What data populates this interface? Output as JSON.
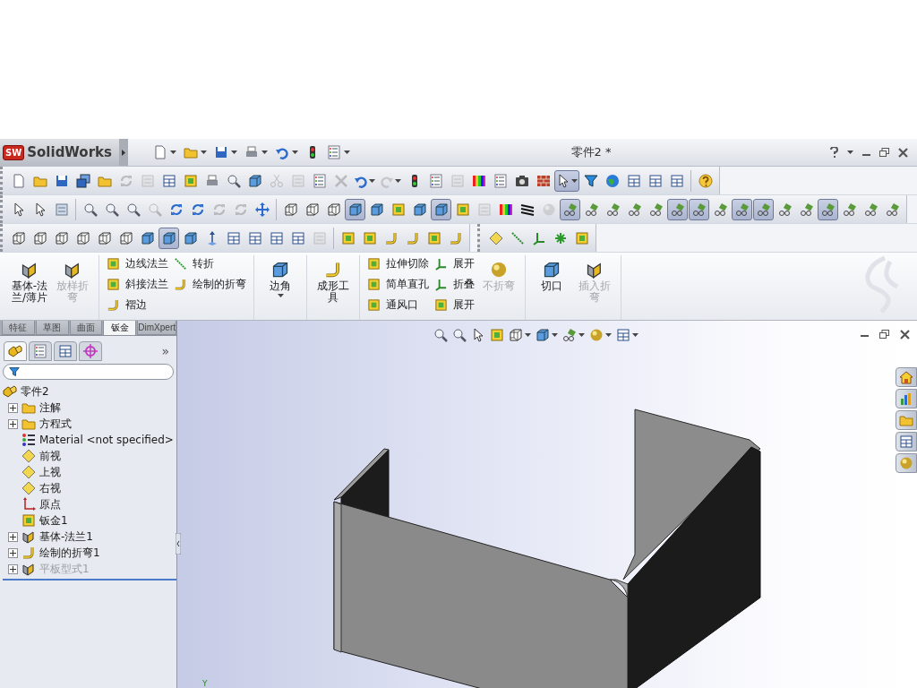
{
  "app": {
    "logo_badge": "SW",
    "logo": "SolidWorks",
    "title": "零件2 *"
  },
  "quick_access": [
    {
      "kind": "page",
      "menu": true
    },
    {
      "kind": "folder",
      "menu": true
    },
    {
      "kind": "save",
      "menu": true
    },
    {
      "kind": "print",
      "menu": true
    },
    {
      "kind": "undo",
      "menu": true
    },
    {
      "kind": "traffic",
      "menu": false
    },
    {
      "kind": "list",
      "menu": true
    }
  ],
  "toolbar_rows": [
    {
      "toolbars": [
        {
          "groups": [
            {
              "buttons": [
                {
                  "kind": "page",
                  "selected": false,
                  "disabled": false
                },
                {
                  "kind": "folder",
                  "selected": false,
                  "disabled": false
                },
                {
                  "kind": "save",
                  "selected": false,
                  "disabled": false
                },
                {
                  "kind": "windows",
                  "selected": false,
                  "disabled": false
                },
                {
                  "kind": "folder",
                  "selected": false,
                  "disabled": false
                },
                {
                  "kind": "rotate",
                  "selected": false,
                  "disabled": true
                },
                {
                  "kind": "tile",
                  "selected": false,
                  "disabled": true
                },
                {
                  "kind": "layout",
                  "selected": false,
                  "disabled": false
                },
                {
                  "kind": "sheet",
                  "selected": false,
                  "disabled": false
                },
                {
                  "kind": "print",
                  "selected": false,
                  "disabled": false
                },
                {
                  "kind": "zoom",
                  "selected": false,
                  "disabled": false
                },
                {
                  "kind": "cube",
                  "selected": false,
                  "disabled": false
                },
                {
                  "kind": "scissors",
                  "selected": false,
                  "disabled": true
                },
                {
                  "kind": "tile",
                  "selected": false,
                  "disabled": true
                },
                {
                  "kind": "list",
                  "selected": false,
                  "disabled": false
                },
                {
                  "kind": "delete",
                  "selected": false,
                  "disabled": true
                },
                {
                  "kind": "undo",
                  "selected": false,
                  "disabled": false,
                  "menu": true
                },
                {
                  "kind": "redo",
                  "selected": false,
                  "disabled": true,
                  "menu": true
                },
                {
                  "kind": "traffic",
                  "selected": false,
                  "disabled": false
                },
                {
                  "kind": "list",
                  "selected": false,
                  "disabled": false
                },
                {
                  "kind": "tile",
                  "selected": false,
                  "disabled": true
                },
                {
                  "kind": "rainbow",
                  "selected": false,
                  "disabled": false
                },
                {
                  "kind": "list",
                  "selected": false,
                  "disabled": false
                },
                {
                  "kind": "camera",
                  "selected": false,
                  "disabled": false
                },
                {
                  "kind": "brick",
                  "selected": false,
                  "disabled": false
                },
                {
                  "kind": "pointer",
                  "selected": true,
                  "disabled": false,
                  "menu": true
                },
                {
                  "kind": "filter",
                  "selected": false,
                  "disabled": false
                },
                {
                  "kind": "globe",
                  "selected": false,
                  "disabled": false
                },
                {
                  "kind": "layout",
                  "selected": false,
                  "disabled": false
                },
                {
                  "kind": "layout",
                  "selected": false,
                  "disabled": false
                },
                {
                  "kind": "layout",
                  "selected": false,
                  "disabled": false
                }
              ]
            },
            {
              "buttons": [
                {
                  "kind": "help",
                  "selected": false,
                  "disabled": false
                }
              ]
            }
          ]
        }
      ]
    },
    {
      "toolbars": [
        {
          "groups": [
            {
              "buttons": [
                {
                  "kind": "pointer",
                  "selected": false,
                  "disabled": false
                },
                {
                  "kind": "pointer",
                  "selected": false,
                  "disabled": false
                },
                {
                  "kind": "tile",
                  "selected": false,
                  "disabled": false
                }
              ]
            },
            {
              "buttons": [
                {
                  "kind": "zoom",
                  "selected": false,
                  "disabled": false
                },
                {
                  "kind": "zoom",
                  "selected": false,
                  "disabled": false
                },
                {
                  "kind": "zoom",
                  "selected": false,
                  "disabled": false
                },
                {
                  "kind": "zoom",
                  "selected": false,
                  "disabled": true
                },
                {
                  "kind": "rotate",
                  "selected": false,
                  "disabled": false
                },
                {
                  "kind": "rotate",
                  "selected": false,
                  "disabled": false
                },
                {
                  "kind": "rotate",
                  "selected": false,
                  "disabled": true
                },
                {
                  "kind": "rotate",
                  "selected": false,
                  "disabled": true
                },
                {
                  "kind": "pan",
                  "selected": false,
                  "disabled": false
                }
              ]
            },
            {
              "buttons": [
                {
                  "kind": "wirecube",
                  "selected": false,
                  "disabled": false
                },
                {
                  "kind": "wirecube",
                  "selected": false,
                  "disabled": false
                },
                {
                  "kind": "wirecube",
                  "selected": false,
                  "disabled": false
                },
                {
                  "kind": "cube",
                  "selected": true,
                  "disabled": false
                },
                {
                  "kind": "cube",
                  "selected": false,
                  "disabled": false
                },
                {
                  "kind": "sheet",
                  "selected": false,
                  "disabled": false
                },
                {
                  "kind": "cube",
                  "selected": false,
                  "disabled": false
                },
                {
                  "kind": "cube",
                  "selected": true,
                  "disabled": false
                },
                {
                  "kind": "sheet",
                  "selected": false,
                  "disabled": false
                },
                {
                  "kind": "tile",
                  "selected": false,
                  "disabled": true
                },
                {
                  "kind": "rainbow",
                  "selected": false,
                  "disabled": false
                },
                {
                  "kind": "zebra",
                  "selected": false,
                  "disabled": false
                },
                {
                  "kind": "sphere",
                  "selected": false,
                  "disabled": true
                },
                {
                  "kind": "glasses",
                  "selected": true,
                  "disabled": false
                },
                {
                  "kind": "glasses",
                  "selected": false,
                  "disabled": false
                },
                {
                  "kind": "glasses",
                  "selected": false,
                  "disabled": false
                },
                {
                  "kind": "glasses",
                  "selected": false,
                  "disabled": false
                },
                {
                  "kind": "glasses",
                  "selected": false,
                  "disabled": false
                },
                {
                  "kind": "glasses",
                  "selected": true,
                  "disabled": false
                },
                {
                  "kind": "glasses",
                  "selected": true,
                  "disabled": false
                },
                {
                  "kind": "glasses",
                  "selected": false,
                  "disabled": false
                },
                {
                  "kind": "glasses",
                  "selected": true,
                  "disabled": false
                },
                {
                  "kind": "glasses",
                  "selected": true,
                  "disabled": false
                },
                {
                  "kind": "glasses",
                  "selected": false,
                  "disabled": false
                },
                {
                  "kind": "glasses",
                  "selected": false,
                  "disabled": false
                },
                {
                  "kind": "glasses",
                  "selected": true,
                  "disabled": false
                },
                {
                  "kind": "glasses",
                  "selected": false,
                  "disabled": false
                },
                {
                  "kind": "glasses",
                  "selected": false,
                  "disabled": false
                },
                {
                  "kind": "glasses",
                  "selected": false,
                  "disabled": false
                }
              ]
            }
          ]
        }
      ]
    },
    {
      "toolbars": [
        {
          "groups": [
            {
              "buttons": [
                {
                  "kind": "wirecube",
                  "selected": false,
                  "disabled": false
                },
                {
                  "kind": "wirecube",
                  "selected": false,
                  "disabled": false
                },
                {
                  "kind": "wirecube",
                  "selected": false,
                  "disabled": false
                },
                {
                  "kind": "wirecube",
                  "selected": false,
                  "disabled": false
                },
                {
                  "kind": "wirecube",
                  "selected": false,
                  "disabled": false
                },
                {
                  "kind": "wirecube",
                  "selected": false,
                  "disabled": false
                },
                {
                  "kind": "cube",
                  "selected": false,
                  "disabled": false
                },
                {
                  "kind": "cube",
                  "selected": true,
                  "disabled": false
                },
                {
                  "kind": "cube",
                  "selected": false,
                  "disabled": false
                },
                {
                  "kind": "arrow",
                  "selected": false,
                  "disabled": false
                },
                {
                  "kind": "layout",
                  "selected": false,
                  "disabled": false
                },
                {
                  "kind": "layout",
                  "selected": false,
                  "disabled": false
                },
                {
                  "kind": "layout",
                  "selected": false,
                  "disabled": false
                },
                {
                  "kind": "layout",
                  "selected": false,
                  "disabled": false
                },
                {
                  "kind": "tile",
                  "selected": false,
                  "disabled": true
                }
              ]
            },
            {
              "buttons": [
                {
                  "kind": "sheet",
                  "selected": false,
                  "disabled": false
                },
                {
                  "kind": "sheet",
                  "selected": false,
                  "disabled": false
                },
                {
                  "kind": "bend",
                  "selected": false,
                  "disabled": false
                },
                {
                  "kind": "bend",
                  "selected": false,
                  "disabled": false
                },
                {
                  "kind": "sheet",
                  "selected": false,
                  "disabled": false
                },
                {
                  "kind": "bend",
                  "selected": false,
                  "disabled": false
                }
              ]
            }
          ]
        },
        {
          "groups": [
            {
              "buttons": [
                {
                  "kind": "plane",
                  "selected": false,
                  "disabled": false
                },
                {
                  "kind": "line",
                  "selected": false,
                  "disabled": false
                },
                {
                  "kind": "axes",
                  "selected": false,
                  "disabled": false
                },
                {
                  "kind": "point",
                  "selected": false,
                  "disabled": false
                },
                {
                  "kind": "sheet",
                  "selected": false,
                  "disabled": false
                }
              ]
            }
          ]
        }
      ]
    }
  ],
  "ribbon": [
    {
      "items": [
        {
          "kind": "large",
          "label": "基体-法兰/薄片",
          "disabled": false,
          "menu": false
        },
        {
          "kind": "large",
          "label": "放样折弯",
          "disabled": true,
          "menu": false
        }
      ]
    },
    {
      "items": [
        {
          "kind": "small",
          "label": "边线法兰",
          "disabled": false
        },
        {
          "kind": "small",
          "label": "斜接法兰",
          "disabled": false
        },
        {
          "kind": "small",
          "label": "褶边",
          "disabled": false
        },
        {
          "kind": "small",
          "label": "转折",
          "disabled": false
        },
        {
          "kind": "small",
          "label": "绘制的折弯",
          "disabled": false
        }
      ]
    },
    {
      "items": [
        {
          "kind": "large",
          "label": "边角",
          "disabled": false,
          "menu": true
        }
      ]
    },
    {
      "items": [
        {
          "kind": "large",
          "label": "成形工具",
          "disabled": false,
          "menu": false
        }
      ]
    },
    {
      "items": [
        {
          "kind": "small",
          "label": "拉伸切除",
          "disabled": false
        },
        {
          "kind": "small",
          "label": "简单直孔",
          "disabled": false
        },
        {
          "kind": "small",
          "label": "通风口",
          "disabled": false
        },
        {
          "kind": "small",
          "label": "展开",
          "disabled": false
        },
        {
          "kind": "small",
          "label": "折叠",
          "disabled": false
        },
        {
          "kind": "small",
          "label": "展开",
          "disabled": false
        },
        {
          "kind": "large",
          "label": "不折弯",
          "disabled": true,
          "menu": false
        }
      ]
    },
    {
      "items": [
        {
          "kind": "large",
          "label": "切口",
          "disabled": false,
          "menu": false
        },
        {
          "kind": "large",
          "label": "插入折弯",
          "disabled": true,
          "menu": false
        }
      ]
    }
  ],
  "tabs": [
    {
      "label": "特征",
      "selected": false
    },
    {
      "label": "草图",
      "selected": false
    },
    {
      "label": "曲面",
      "selected": false
    },
    {
      "label": "钣金",
      "selected": true
    },
    {
      "label": "DimXpert",
      "selected": false
    }
  ],
  "panel_tabs": [
    {
      "kind": "part",
      "selected": true
    },
    {
      "kind": "list",
      "selected": false
    },
    {
      "kind": "layout",
      "selected": false
    },
    {
      "kind": "target",
      "selected": false
    }
  ],
  "panel_more": "»",
  "feature_tree": {
    "label": "零件2",
    "children": [
      {
        "label": "注解",
        "has_children": true,
        "disabled": false
      },
      {
        "label": "方程式",
        "has_children": true,
        "disabled": false
      },
      {
        "label": "Material <not specified>",
        "has_children": false,
        "disabled": false
      },
      {
        "label": "前视",
        "has_children": false,
        "disabled": false
      },
      {
        "label": "上视",
        "has_children": false,
        "disabled": false
      },
      {
        "label": "右视",
        "has_children": false,
        "disabled": false
      },
      {
        "label": "原点",
        "has_children": false,
        "disabled": false
      },
      {
        "label": "钣金1",
        "has_children": false,
        "disabled": false
      },
      {
        "label": "基体-法兰1",
        "has_children": true,
        "disabled": false
      },
      {
        "label": "绘制的折弯1",
        "has_children": true,
        "disabled": false
      },
      {
        "label": "平板型式1",
        "has_children": true,
        "disabled": true
      }
    ]
  },
  "viewport": {
    "hud": [
      {
        "kind": "zoom",
        "menu": false
      },
      {
        "kind": "zoom",
        "menu": false
      },
      {
        "kind": "pointer",
        "menu": false
      },
      {
        "kind": "sheet",
        "menu": false
      },
      {
        "kind": "wirecube",
        "menu": true
      },
      {
        "kind": "cube",
        "menu": true
      },
      {
        "kind": "glasses",
        "menu": true
      },
      {
        "kind": "sphere",
        "menu": true
      },
      {
        "kind": "layout",
        "menu": true
      }
    ],
    "task_pane": [
      {
        "kind": "home"
      },
      {
        "kind": "chart"
      },
      {
        "kind": "folder"
      },
      {
        "kind": "layout"
      },
      {
        "kind": "sphere"
      }
    ],
    "axis_label": "Y"
  }
}
